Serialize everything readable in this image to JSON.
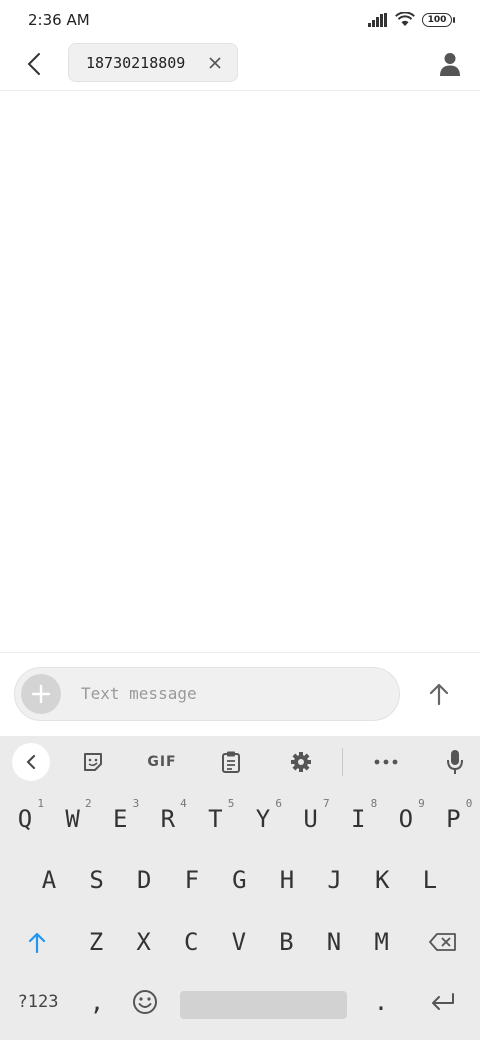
{
  "status_bar": {
    "time": "2:36 AM",
    "battery": "100"
  },
  "header": {
    "recipient": "18730218809"
  },
  "compose": {
    "placeholder": "Text message"
  },
  "keyboard": {
    "toolbar": {
      "gif": "GIF"
    },
    "row1": [
      {
        "k": "Q",
        "n": "1"
      },
      {
        "k": "W",
        "n": "2"
      },
      {
        "k": "E",
        "n": "3"
      },
      {
        "k": "R",
        "n": "4"
      },
      {
        "k": "T",
        "n": "5"
      },
      {
        "k": "Y",
        "n": "6"
      },
      {
        "k": "U",
        "n": "7"
      },
      {
        "k": "I",
        "n": "8"
      },
      {
        "k": "O",
        "n": "9"
      },
      {
        "k": "P",
        "n": "0"
      }
    ],
    "row2": [
      "A",
      "S",
      "D",
      "F",
      "G",
      "H",
      "J",
      "K",
      "L"
    ],
    "row3": [
      "Z",
      "X",
      "C",
      "V",
      "B",
      "N",
      "M"
    ],
    "bottom": {
      "symbols": "?123",
      "comma": ",",
      "period": "."
    }
  },
  "colors": {
    "shift_accent": "#2196f3",
    "keyboard_bg": "#ebebeb"
  }
}
